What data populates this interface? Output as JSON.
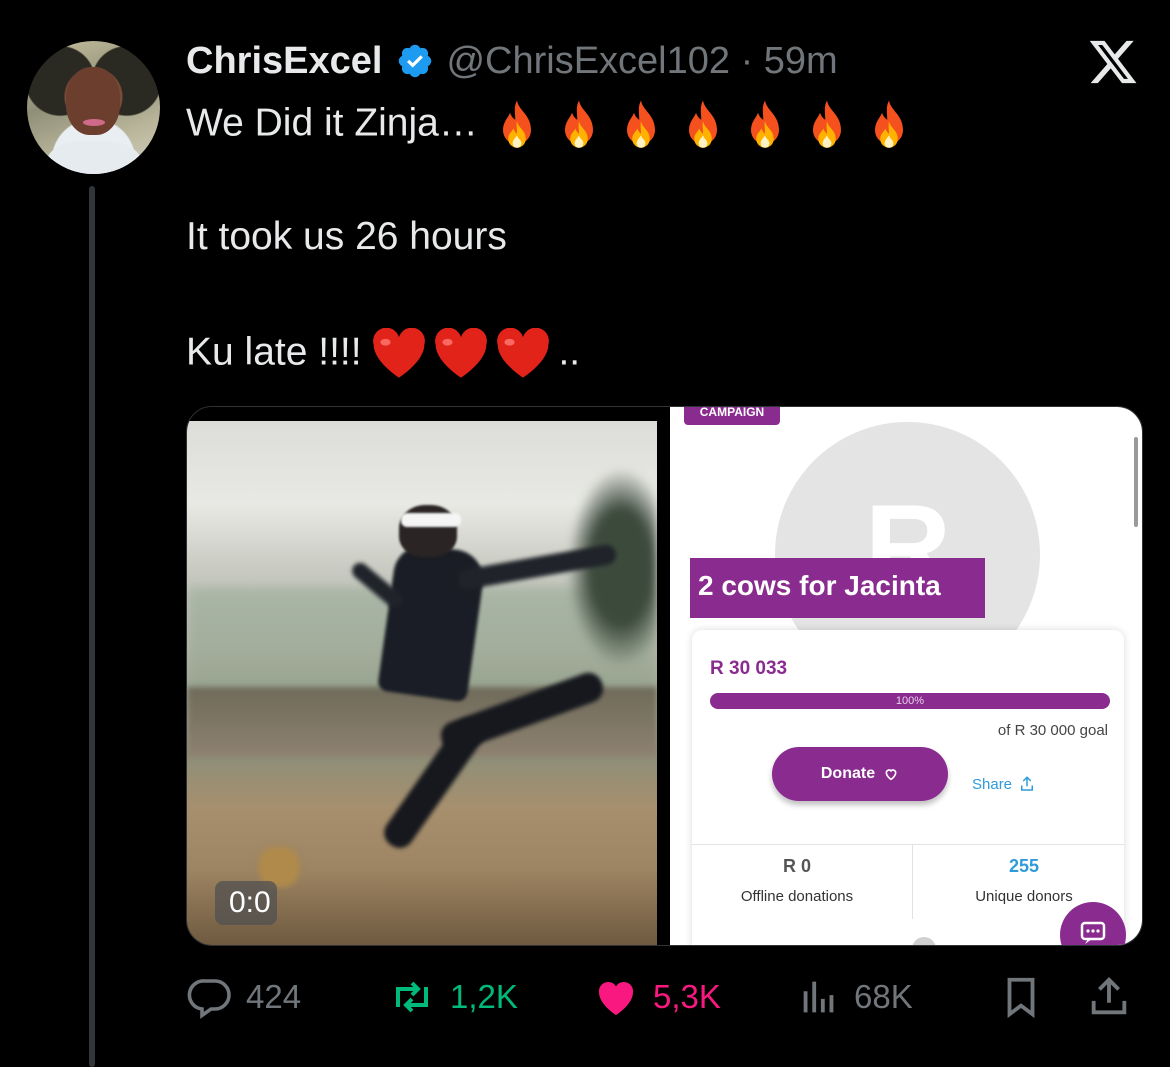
{
  "tweet": {
    "author_name": "ChrisExcel",
    "handle_time": "@ChrisExcel102 · 59m",
    "lines": [
      "We Did it Zinja…",
      "It took us 26 hours",
      "Ku late !!!!"
    ],
    "trailing_dots": "..",
    "fire_count": 7,
    "heart_count": 3
  },
  "video": {
    "timestamp": "0:0"
  },
  "campaign_screenshot": {
    "tag": "CAMPAIGN",
    "avatar_letter": "R",
    "title": "2 cows for Jacinta",
    "raised": "R 30 033",
    "progress_label": "100%",
    "progress_fraction": 1.0,
    "goal": "of R 30 000 goal",
    "donate_label": "Donate",
    "share_label": "Share",
    "stats": [
      {
        "value": "R 0",
        "label": "Offline donations"
      },
      {
        "value": "255",
        "label": "Unique donors"
      }
    ],
    "brand_color": "#8a2c8f"
  },
  "actions": {
    "replies": "424",
    "reposts": "1,2K",
    "likes": "5,3K",
    "views": "68K"
  },
  "colors": {
    "background": "#000000",
    "text": "#e7e9ea",
    "muted": "#71767b",
    "repost_active": "#00ba7c",
    "like_active": "#f91880",
    "verified": "#1d9bf0"
  }
}
